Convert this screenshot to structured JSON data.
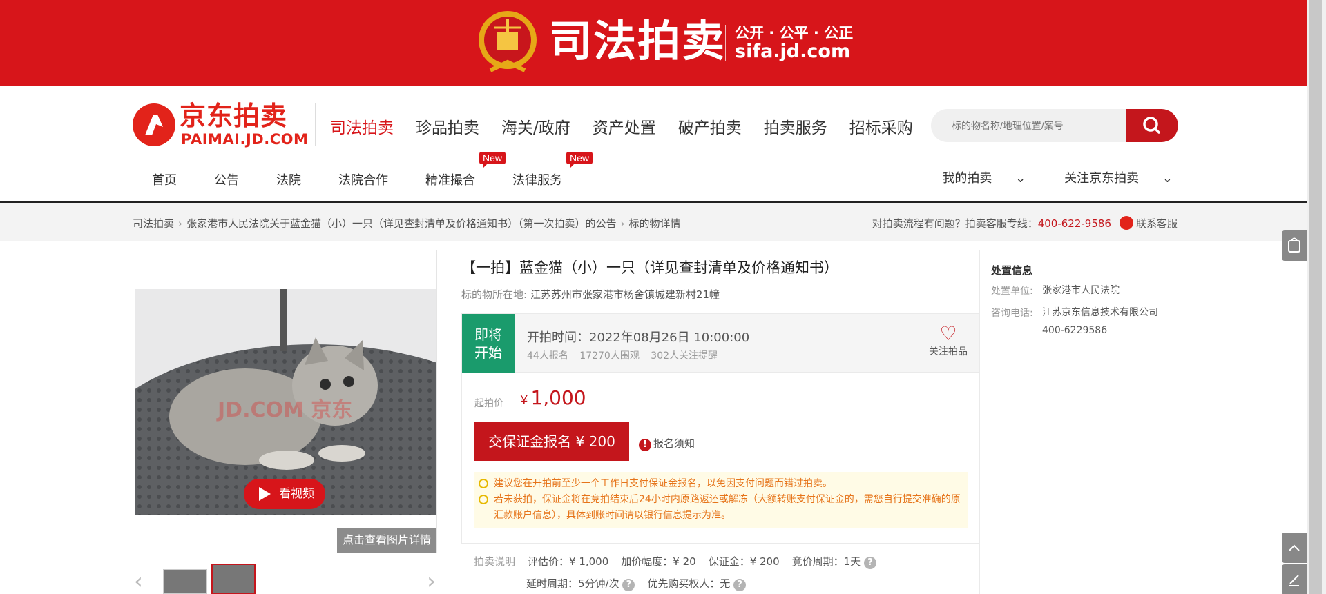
{
  "banner": {
    "title": "司法拍卖",
    "slogan": "公开 · 公平 · 公正",
    "domain": "sifa.jd.com"
  },
  "logo": {
    "cn": "京东拍卖",
    "en": "PAIMAI.JD.COM"
  },
  "main_nav": [
    "司法拍卖",
    "珍品拍卖",
    "海关/政府",
    "资产处置",
    "破产拍卖",
    "拍卖服务",
    "招标采购"
  ],
  "search": {
    "placeholder": "标的物名称/地理位置/案号"
  },
  "sub_nav": [
    {
      "label": "首页",
      "badge": ""
    },
    {
      "label": "公告",
      "badge": ""
    },
    {
      "label": "法院",
      "badge": ""
    },
    {
      "label": "法院合作",
      "badge": ""
    },
    {
      "label": "精准撮合",
      "badge": "New"
    },
    {
      "label": "法律服务",
      "badge": "New"
    }
  ],
  "right_links": [
    "我的拍卖",
    "关注京东拍卖"
  ],
  "breadcrumb": [
    "司法拍卖",
    "张家港市人民法院关于蓝金猫（小）一只（详见查封清单及价格通知书）（第一次拍卖）的公告",
    "标的物详情"
  ],
  "hotline": {
    "text": "对拍卖流程有问题？拍卖客服专线：",
    "number": "400-622-9586",
    "service": "联系客服"
  },
  "gallery": {
    "watermark": "JD.COM 京东",
    "video_label": "看视频",
    "detail_label": "点击查看图片详情"
  },
  "item": {
    "title": "【一拍】蓝金猫（小）一只（详见查封清单及价格通知书）",
    "location_label": "标的物所在地:",
    "location": "江苏苏州市张家港市杨舍镇城建新村21幢",
    "status_line1": "即将",
    "status_line2": "开始",
    "start_time": "开拍时间：2022年08月26日 10:00:00",
    "signups": "44人报名",
    "watchers": "17270人围观",
    "reminders": "302人关注提醒",
    "follow_label": "关注拍品",
    "price_label": "起拍价",
    "price_symbol": "¥",
    "price": "1,000",
    "deposit_button": "交保证金报名 ¥ 200",
    "notice_label": "报名须知",
    "tip1": "建议您在开拍前至少一个工作日支付保证金报名，以免因支付问题而错过拍卖。",
    "tip2": "若未获拍，保证金将在竞拍结束后24小时内原路返还或解冻（大额转账支付保证金的，需您自行提交准确的原汇款账户信息），具体到账时间请以银行信息提示为准。"
  },
  "rules": {
    "label": "拍卖说明",
    "appraisal": "评估价：¥ 1,000",
    "increment": "加价幅度：¥ 20",
    "deposit": "保证金：¥ 200",
    "period": "竞价周期：1天",
    "delay": "延时周期：5分钟/次",
    "priority": "优先购买权人：无"
  },
  "dispose": {
    "title": "处置信息",
    "unit_label": "处置单位:",
    "unit": "张家港市人民法院",
    "phone_label": "咨询电话:",
    "phone_org": "江苏京东信息技术有限公司",
    "phone": "400-6229586"
  },
  "colors": {
    "brand_red": "#d7151a",
    "status_green": "#1a9b6c",
    "tip_orange": "#e6741a"
  }
}
